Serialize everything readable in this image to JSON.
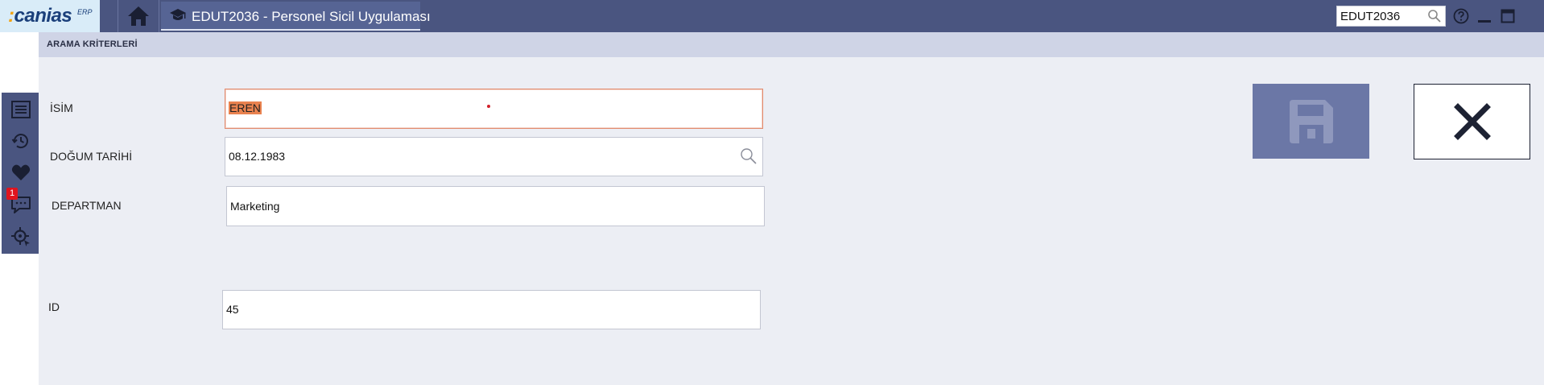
{
  "topbar": {
    "logo_text": "canias",
    "logo_superscript": "ERP",
    "app_tab_title": "EDUT2036 - Personel Sicil Uygulaması",
    "transaction_search_value": "EDUT2036",
    "icons": [
      "home-icon",
      "graduation-cap-icon",
      "search-icon",
      "help-icon",
      "minimize-icon",
      "maximize-icon"
    ]
  },
  "sidebar": {
    "icons": [
      "list-icon",
      "history-clock-icon",
      "favorites-heart-icon",
      "messages-chat-icon",
      "target-settings-icon"
    ],
    "message_badge": "1"
  },
  "section": {
    "title": "ARAMA KRİTERLERİ"
  },
  "form": {
    "isim_label": "İSİM",
    "isim_value": "EREN",
    "dogum_tarihi_label": "DOĞUM TARİHİ",
    "dogum_tarihi_value": "08.12.1983",
    "departman_label": "DEPARTMAN",
    "departman_value": "Marketing",
    "id_label": "ID",
    "id_value": "45"
  },
  "actions": {
    "save_icon": "floppy-disk-icon",
    "close_icon": "close-x-icon"
  },
  "colors": {
    "topbar": "#4a5580",
    "background": "#eceef4",
    "section_header": "#cfd4e6",
    "save_button": "#6b77a6",
    "selection_highlight": "#e9824f",
    "badge": "#e0141e"
  }
}
